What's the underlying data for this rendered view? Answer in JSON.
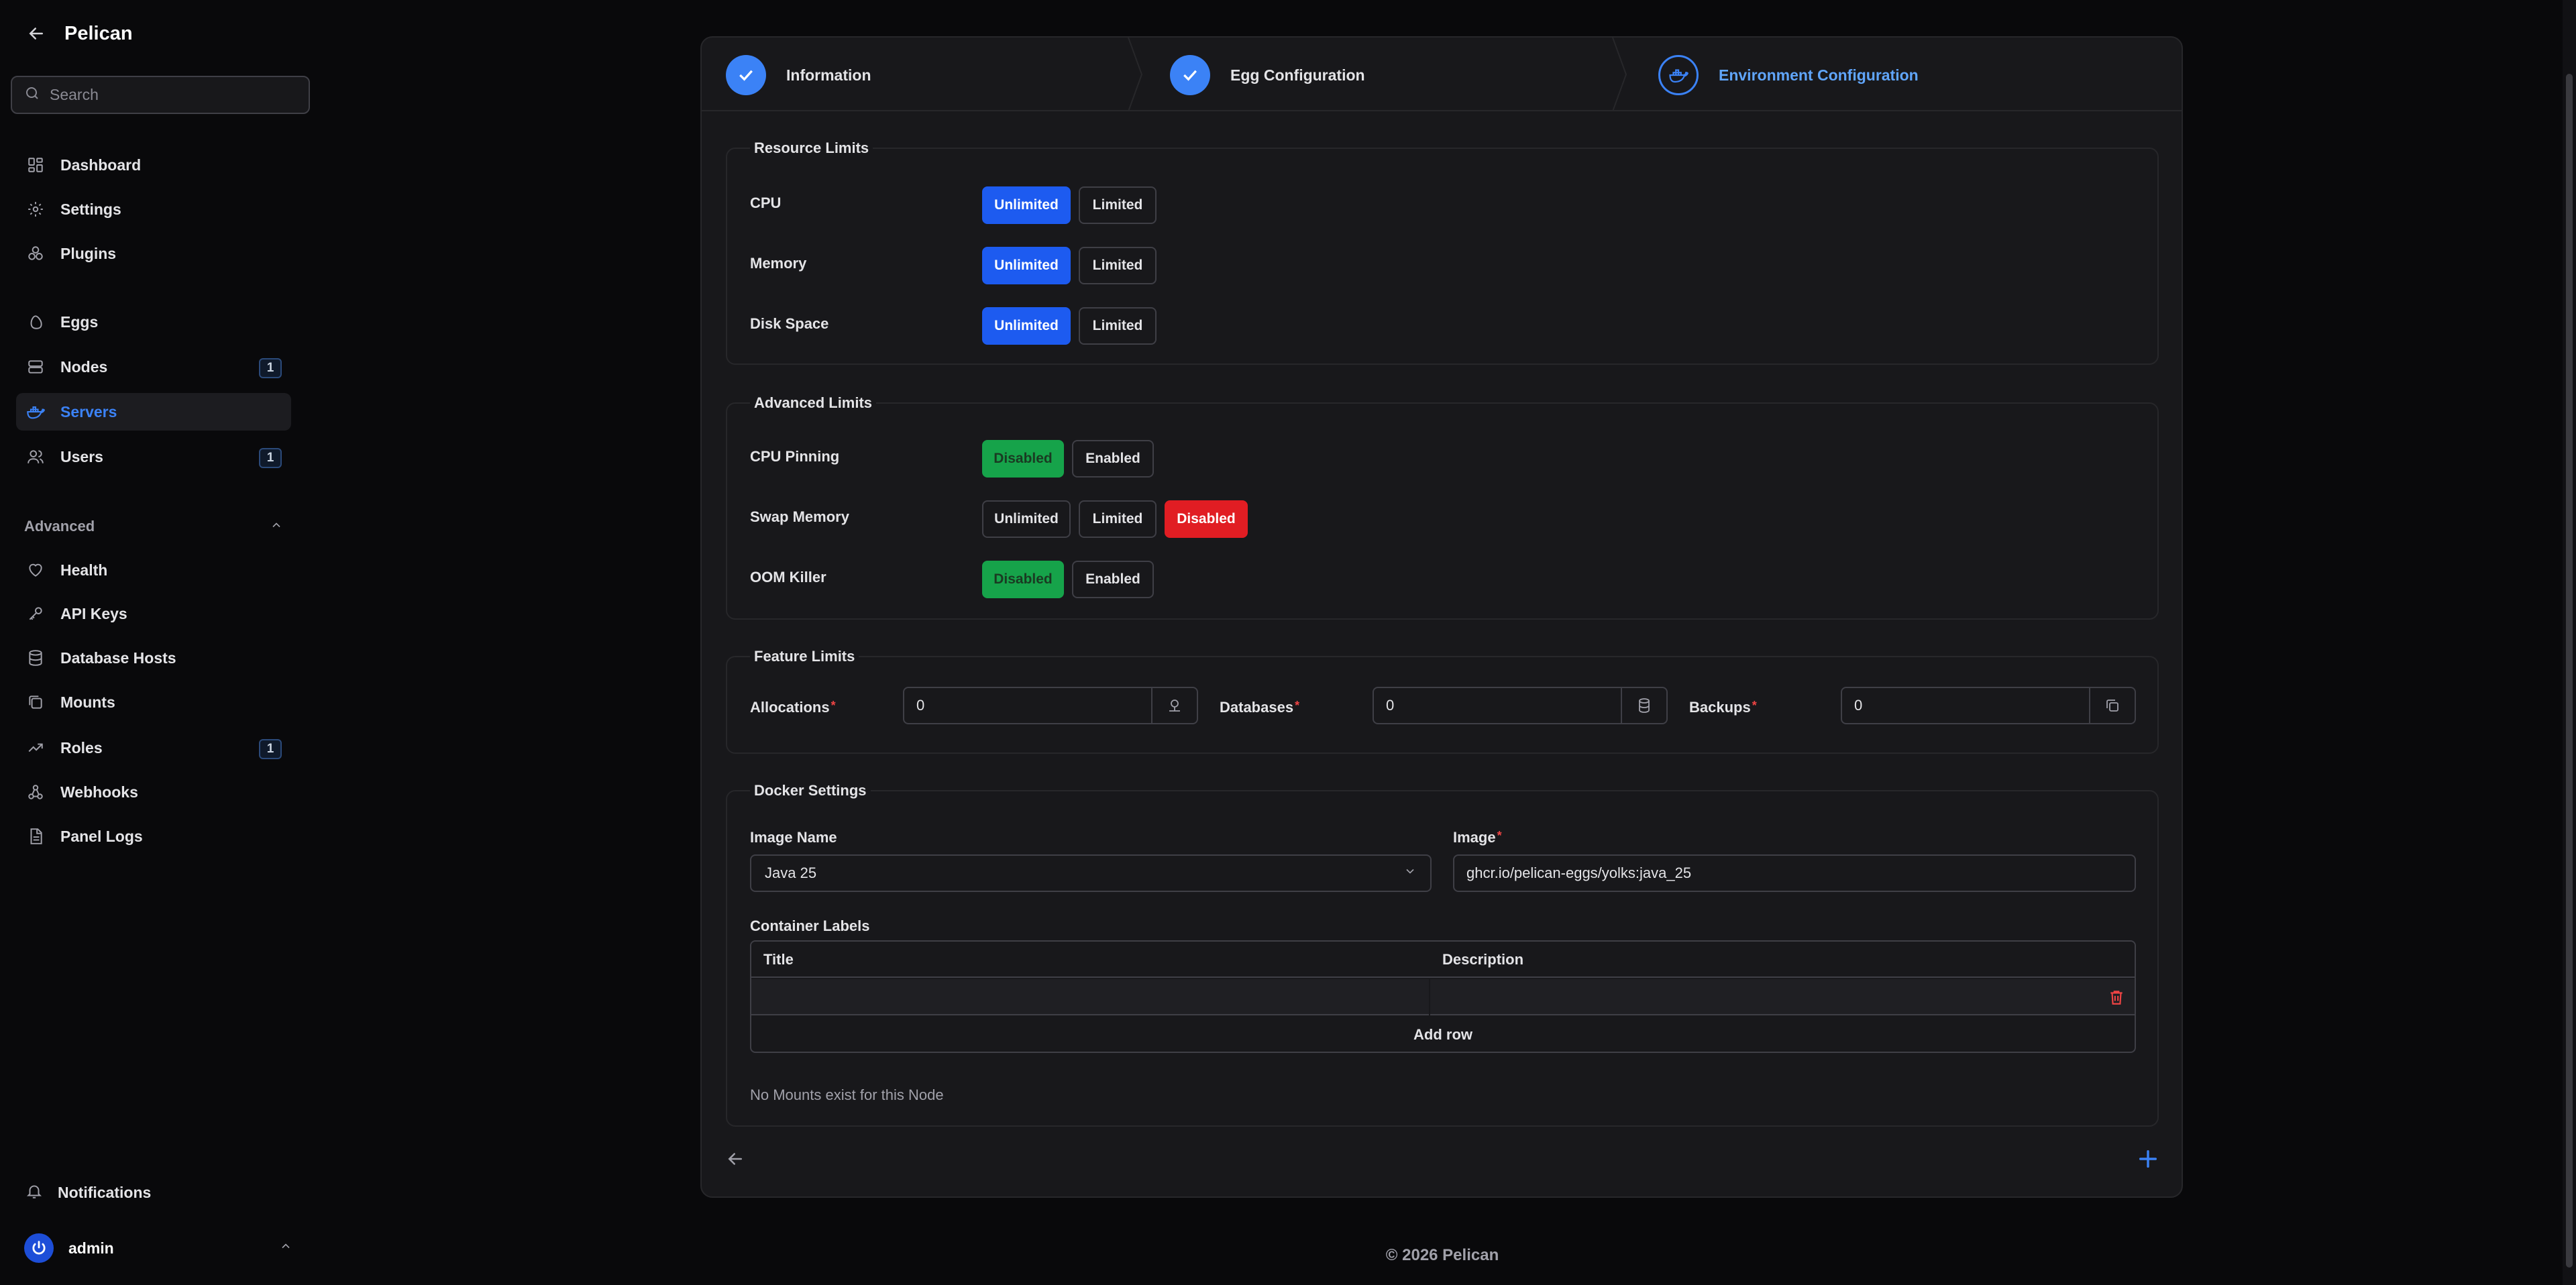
{
  "app": {
    "title": "Pelican"
  },
  "search": {
    "placeholder": "Search"
  },
  "nav": {
    "main": [
      {
        "label": "Dashboard",
        "icon": "dashboard-icon"
      },
      {
        "label": "Settings",
        "icon": "gear-icon"
      },
      {
        "label": "Plugins",
        "icon": "plugins-icon"
      }
    ],
    "resources": [
      {
        "label": "Eggs",
        "icon": "egg-icon"
      },
      {
        "label": "Nodes",
        "icon": "server-icon",
        "badge": "1"
      },
      {
        "label": "Servers",
        "icon": "docker-icon",
        "active": true
      },
      {
        "label": "Users",
        "icon": "users-icon",
        "badge": "1"
      }
    ],
    "advanced_label": "Advanced",
    "advanced": [
      {
        "label": "Health",
        "icon": "heart-icon"
      },
      {
        "label": "API Keys",
        "icon": "key-icon"
      },
      {
        "label": "Database Hosts",
        "icon": "database-icon"
      },
      {
        "label": "Mounts",
        "icon": "mounts-icon"
      },
      {
        "label": "Roles",
        "icon": "roles-icon",
        "badge": "1"
      },
      {
        "label": "Webhooks",
        "icon": "webhook-icon"
      },
      {
        "label": "Panel Logs",
        "icon": "file-icon"
      }
    ],
    "notifications": "Notifications",
    "user": "admin"
  },
  "steps": [
    {
      "label": "Information",
      "state": "done"
    },
    {
      "label": "Egg Configuration",
      "state": "done"
    },
    {
      "label": "Environment Configuration",
      "state": "current"
    }
  ],
  "resource_limits": {
    "title": "Resource Limits",
    "rows": [
      {
        "label": "CPU",
        "options": [
          "Unlimited",
          "Limited"
        ],
        "selected": "Unlimited"
      },
      {
        "label": "Memory",
        "options": [
          "Unlimited",
          "Limited"
        ],
        "selected": "Unlimited"
      },
      {
        "label": "Disk Space",
        "options": [
          "Unlimited",
          "Limited"
        ],
        "selected": "Unlimited"
      }
    ]
  },
  "advanced_limits": {
    "title": "Advanced Limits",
    "rows": [
      {
        "label": "CPU Pinning",
        "options": [
          "Disabled",
          "Enabled"
        ],
        "selected": "Disabled"
      },
      {
        "label": "Swap Memory",
        "options": [
          "Unlimited",
          "Limited",
          "Disabled"
        ],
        "selected": "Disabled"
      },
      {
        "label": "OOM Killer",
        "options": [
          "Disabled",
          "Enabled"
        ],
        "selected": "Disabled"
      }
    ]
  },
  "feature_limits": {
    "title": "Feature Limits",
    "fields": [
      {
        "label": "Allocations",
        "value": "0",
        "icon": "network-icon"
      },
      {
        "label": "Databases",
        "value": "0",
        "icon": "database-icon"
      },
      {
        "label": "Backups",
        "value": "0",
        "icon": "copy-icon"
      }
    ]
  },
  "docker": {
    "title": "Docker Settings",
    "image_name_label": "Image Name",
    "image_name_value": "Java 25",
    "image_label": "Image",
    "image_value": "ghcr.io/pelican-eggs/yolks:java_25",
    "labels_title": "Container Labels",
    "col_title": "Title",
    "col_description": "Description",
    "add_row": "Add row",
    "mounts_note": "No Mounts exist for this Node"
  },
  "colors": {
    "accent": "#3b82f6",
    "selected": "#1d5bf0",
    "success": "#16a34a",
    "danger": "#e11d23"
  },
  "footer": {
    "copyright": "© 2026 Pelican"
  }
}
